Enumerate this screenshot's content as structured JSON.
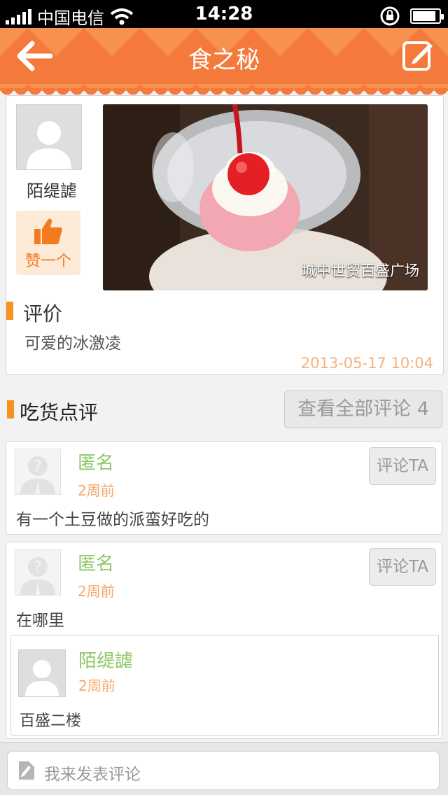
{
  "status_bar": {
    "carrier": "中国电信",
    "time": "14:28"
  },
  "nav": {
    "title": "食之秘",
    "back_icon": "arrow-left-icon",
    "edit_icon": "edit-icon"
  },
  "post": {
    "username": "陌缇謔",
    "like_label": "赞一个",
    "photo_caption": "城中世贸百盛广场",
    "review_title": "评价",
    "review_text": "可爱的冰激凌",
    "timestamp": "2013-05-17 10:04"
  },
  "comments_section": {
    "title": "吃货点评",
    "view_all_label": "查看全部评论 4"
  },
  "comments": [
    {
      "name": "匿名",
      "when": "2周前",
      "text": "有一个土豆做的派蛮好吃的",
      "reply_label": "评论TA"
    },
    {
      "name": "匿名",
      "when": "2周前",
      "text": "在哪里",
      "reply_label": "评论TA",
      "reply": {
        "name": "陌缇謔",
        "when": "2周前",
        "text": "百盛二楼"
      }
    }
  ],
  "input": {
    "placeholder": "我来发表评论"
  },
  "colors": {
    "accent": "#f47a3c",
    "name_green": "#8cc765",
    "time_orange": "#f5a86a"
  }
}
